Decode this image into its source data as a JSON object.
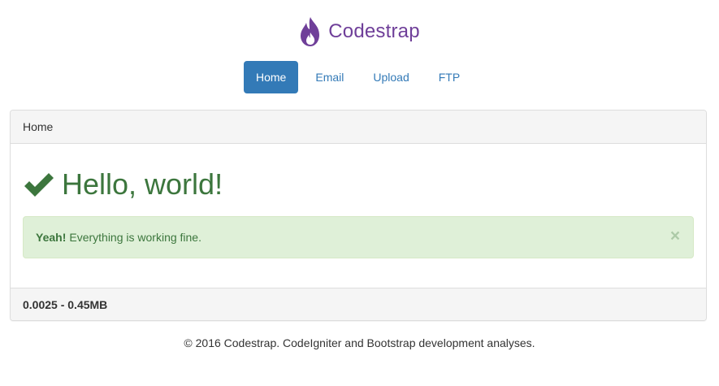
{
  "brand": {
    "name": "Codestrap",
    "icon": "flame-icon",
    "color": "#6f3f99"
  },
  "nav": {
    "items": [
      {
        "label": "Home",
        "active": true
      },
      {
        "label": "Email",
        "active": false
      },
      {
        "label": "Upload",
        "active": false
      },
      {
        "label": "FTP",
        "active": false
      }
    ]
  },
  "panel": {
    "heading": "Home",
    "hello_icon": "checkmark-icon",
    "hello_text": "Hello, world!",
    "alert": {
      "strong": "Yeah!",
      "message": "Everything is working fine.",
      "close": "×"
    },
    "footer_stats": "0.0025 - 0.45MB"
  },
  "footer": {
    "text": "© 2016 Codestrap. CodeIgniter and Bootstrap development analyses."
  },
  "colors": {
    "primary": "#337ab7",
    "success_text": "#3c763d",
    "success_bg": "#dff0d8",
    "brand": "#6f3f99"
  }
}
